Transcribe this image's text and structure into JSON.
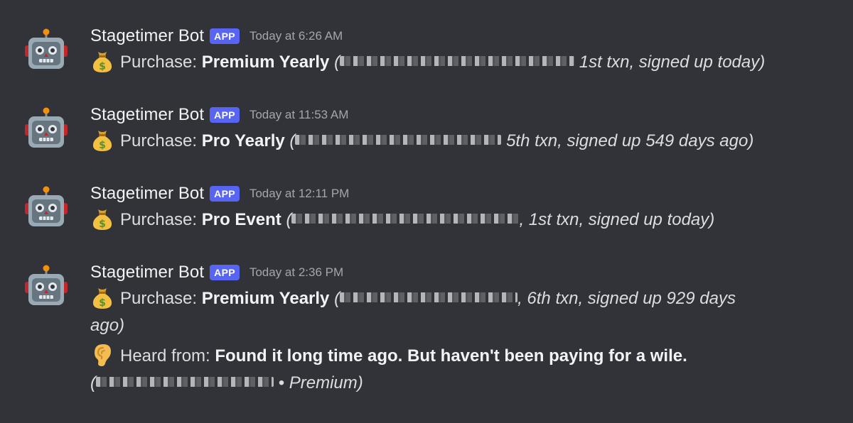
{
  "messages": [
    {
      "author": "Stagetimer Bot",
      "badge": "APP",
      "time": "Today at 6:26 AM",
      "prefix": "Purchase: ",
      "product": "Premium Yearly",
      "open_paren": "(",
      "details": "1st txn, signed up today)"
    },
    {
      "author": "Stagetimer Bot",
      "badge": "APP",
      "time": "Today at 11:53 AM",
      "prefix": "Purchase: ",
      "product": "Pro Yearly",
      "open_paren": "(",
      "details": "5th txn, signed up 549 days ago)"
    },
    {
      "author": "Stagetimer Bot",
      "badge": "APP",
      "time": "Today at 12:11 PM",
      "prefix": "Purchase: ",
      "product": "Pro Event",
      "open_paren": "(",
      "details": ", 1st txn, signed up today)"
    },
    {
      "author": "Stagetimer Bot",
      "badge": "APP",
      "time": "Today at 2:36 PM",
      "prefix": "Purchase: ",
      "product": "Premium Yearly",
      "open_paren": "(",
      "details": ", 6th txn, signed up 929 days",
      "details_cont": "ago)",
      "heard_prefix": "Heard from: ",
      "heard_text": "Found it long time ago. But haven't been paying for a wile.",
      "heard_open": "(",
      "heard_suffix": " • Premium)"
    }
  ],
  "icons": {
    "avatar": "robot-face-icon",
    "purchase": "money-bag-icon",
    "heard": "ear-icon"
  },
  "colors": {
    "background": "#313338",
    "badge": "#5865f2",
    "author": "#f2f3f5",
    "timestamp": "#a3a6ad",
    "text": "#dbdee1"
  }
}
